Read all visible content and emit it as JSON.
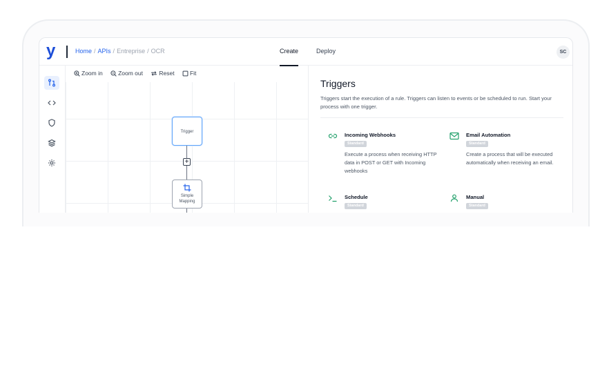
{
  "header": {
    "logo": "y",
    "breadcrumb": [
      "Home",
      "APIs",
      "Entreprise",
      "OCR"
    ],
    "tabs": [
      {
        "label": "Create",
        "active": true
      },
      {
        "label": "Deploy",
        "active": false
      }
    ],
    "avatar_initials": "SC"
  },
  "rail": {
    "items": [
      {
        "icon": "flow-icon",
        "active": true
      },
      {
        "icon": "code-icon",
        "active": false
      },
      {
        "icon": "shield-icon",
        "active": false
      },
      {
        "icon": "layers-icon",
        "active": false
      },
      {
        "icon": "gear-icon",
        "active": false
      }
    ]
  },
  "canvas": {
    "toolbar": {
      "zoom_in": "Zoom in",
      "zoom_out": "Zoom out",
      "reset": "Reset",
      "fit": "Fit"
    },
    "nodes": {
      "trigger": "Trigger",
      "mapping_line1": "Simple",
      "mapping_line2": "Mapping"
    }
  },
  "panel": {
    "title": "Triggers",
    "description": "Triggers start the execution of a rule. Triggers can listen to events or be scheduled to run. Start your process with one trigger.",
    "cards": [
      {
        "title": "Incoming Webhooks",
        "badge": "Standard",
        "description": "Execute a process when receiving HTTP data in POST or GET with Incoming webhooks",
        "icon": "link-icon"
      },
      {
        "title": "Email Automation",
        "badge": "Standard",
        "description": "Create a process that will be executed automatically when receiving an email.",
        "icon": "mail-icon"
      },
      {
        "title": "Schedule",
        "badge": "Standard",
        "description": "",
        "icon": "terminal-icon"
      },
      {
        "title": "Manual",
        "badge": "Standard",
        "description": "",
        "icon": "user-icon"
      }
    ],
    "accent_color": "#22a06b"
  }
}
